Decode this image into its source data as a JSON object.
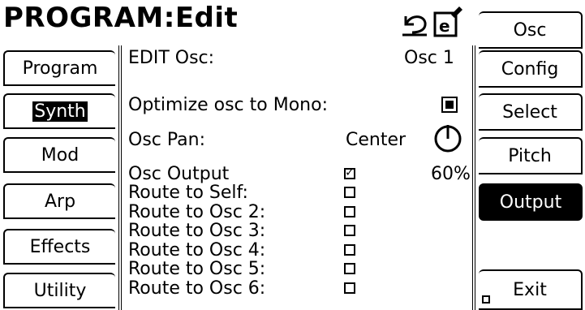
{
  "header": {
    "title": "PROGRAM:Edit"
  },
  "icons": {
    "undo": "undo-icon",
    "edit": "edit-document-icon"
  },
  "left_tabs": [
    "Program",
    "Synth",
    "Mod",
    "Arp",
    "Effects",
    "Utility"
  ],
  "left_selected": "Synth",
  "right_tabs": [
    "Osc",
    "Config",
    "Select",
    "Pitch",
    "Output",
    "Exit"
  ],
  "right_active": "Output",
  "panel": {
    "edit_label": "EDIT Osc:",
    "edit_value": "Osc 1",
    "optimize_label": "Optimize osc to Mono:",
    "optimize_checked": true,
    "pan_label": "Osc Pan:",
    "pan_value": "Center",
    "output_label": "Osc Output",
    "output_checked": true,
    "output_percent": "60%",
    "routes": [
      {
        "label": "Route to Self:",
        "checked": false
      },
      {
        "label": "Route to Osc 2:",
        "checked": false
      },
      {
        "label": "Route to Osc 3:",
        "checked": false
      },
      {
        "label": "Route to Osc 4:",
        "checked": false
      },
      {
        "label": "Route to Osc 5:",
        "checked": false
      },
      {
        "label": "Route to Osc 6:",
        "checked": false
      }
    ]
  }
}
